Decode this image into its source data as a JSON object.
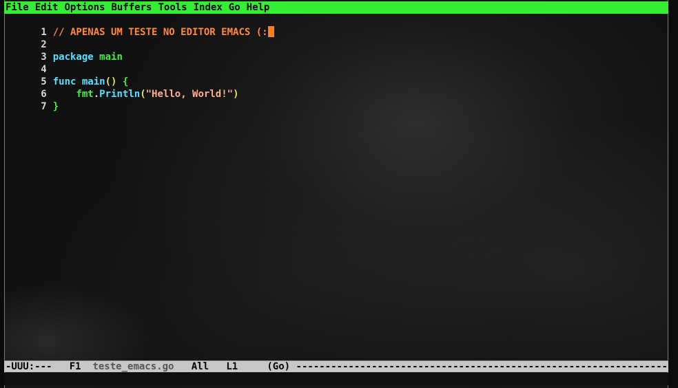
{
  "menubar": {
    "items": [
      "File",
      "Edit",
      "Options",
      "Buffers",
      "Tools",
      "Index",
      "Go",
      "Help"
    ],
    "color": "#33ee33"
  },
  "editor": {
    "lines": [
      {
        "num": "1",
        "text": "// APENAS UM TESTE NO EDITOR EMACS (:"
      },
      {
        "num": "2",
        "text": ""
      },
      {
        "num": "3",
        "kw": "package",
        "rest": "main"
      },
      {
        "num": "4",
        "text": ""
      },
      {
        "num": "5",
        "kw": "func",
        "name": "main",
        "parens": "()",
        "brace": "{"
      },
      {
        "num": "6",
        "pkg": "fmt",
        "dot": ".",
        "fn": "Println",
        "open": "(",
        "str": "\"Hello, World!\"",
        "close": ")"
      },
      {
        "num": "7",
        "brace": "}"
      }
    ],
    "cursor_color": "#ff7f1e"
  },
  "modeline": {
    "status": "-UUU:---",
    "frame": "F1",
    "buffer": "teste_emacs.go",
    "position": "All",
    "line": "L1",
    "mode": "(Go)",
    "dashes": "--------------------------------------------------------------------------------------"
  }
}
